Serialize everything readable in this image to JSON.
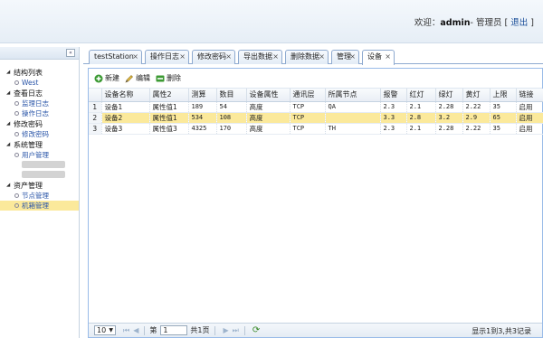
{
  "header": {
    "welcome_prefix": "欢迎：",
    "username": "admin",
    "role": "- 管理员 [",
    "logout": "退出",
    "suffix": "]"
  },
  "sidebar": {
    "collapse_icon": "«",
    "groups": [
      {
        "title": "结构列表",
        "items": [
          {
            "label": "West",
            "active": false
          }
        ]
      },
      {
        "title": "查看日志",
        "items": [
          {
            "label": "监理日志",
            "active": false
          },
          {
            "label": "操作日志",
            "active": false
          }
        ]
      },
      {
        "title": "修改密码",
        "items": [
          {
            "label": "修改密码",
            "active": false
          }
        ]
      },
      {
        "title": "系统管理",
        "items": [
          {
            "label": "用户管理",
            "active": false
          },
          {
            "label": "",
            "active": false,
            "blurred": true
          },
          {
            "label": "",
            "active": false,
            "blurred": true
          }
        ]
      },
      {
        "title": "资产管理",
        "items": [
          {
            "label": "节点管理",
            "active": false
          },
          {
            "label": "机箱管理",
            "active": true
          }
        ]
      }
    ]
  },
  "tabs": [
    {
      "label": "testStation",
      "active": false
    },
    {
      "label": "操作日志",
      "active": false
    },
    {
      "label": "修改密码",
      "active": false
    },
    {
      "label": "导出数据",
      "active": false
    },
    {
      "label": "删除数据",
      "active": false
    },
    {
      "label": "管理",
      "active": false
    },
    {
      "label": "设备",
      "active": true
    }
  ],
  "toolbar": {
    "new_label": "新建",
    "edit_label": "编辑",
    "delete_label": "删除"
  },
  "grid": {
    "columns": [
      "",
      "设备名称",
      "属性2",
      "测算",
      "数目",
      "设备属性",
      "通讯层",
      "所属节点",
      "报警",
      "红灯",
      "绿灯",
      "黄灯",
      "上限",
      "链接"
    ],
    "rows": [
      [
        "1",
        "设备1",
        "属性值1",
        "189",
        "54",
        "高度",
        "TCP",
        "QA",
        "2.3",
        "2.1",
        "2.28",
        "2.22",
        "35",
        "启用"
      ],
      [
        "2",
        "设备2",
        "属性值1",
        "534",
        "108",
        "高度",
        "TCP",
        "",
        "3.3",
        "2.8",
        "3.2",
        "2.9",
        "65",
        "启用"
      ],
      [
        "3",
        "设备3",
        "属性值3",
        "4325",
        "170",
        "高度",
        "TCP",
        "TH",
        "2.3",
        "2.1",
        "2.28",
        "2.22",
        "35",
        "启用"
      ]
    ],
    "selected_row": 1
  },
  "pager": {
    "page_size": "10",
    "page_prefix": "第",
    "page_value": "1",
    "page_suffix": "共1页",
    "info": "显示1到3,共3记录"
  }
}
